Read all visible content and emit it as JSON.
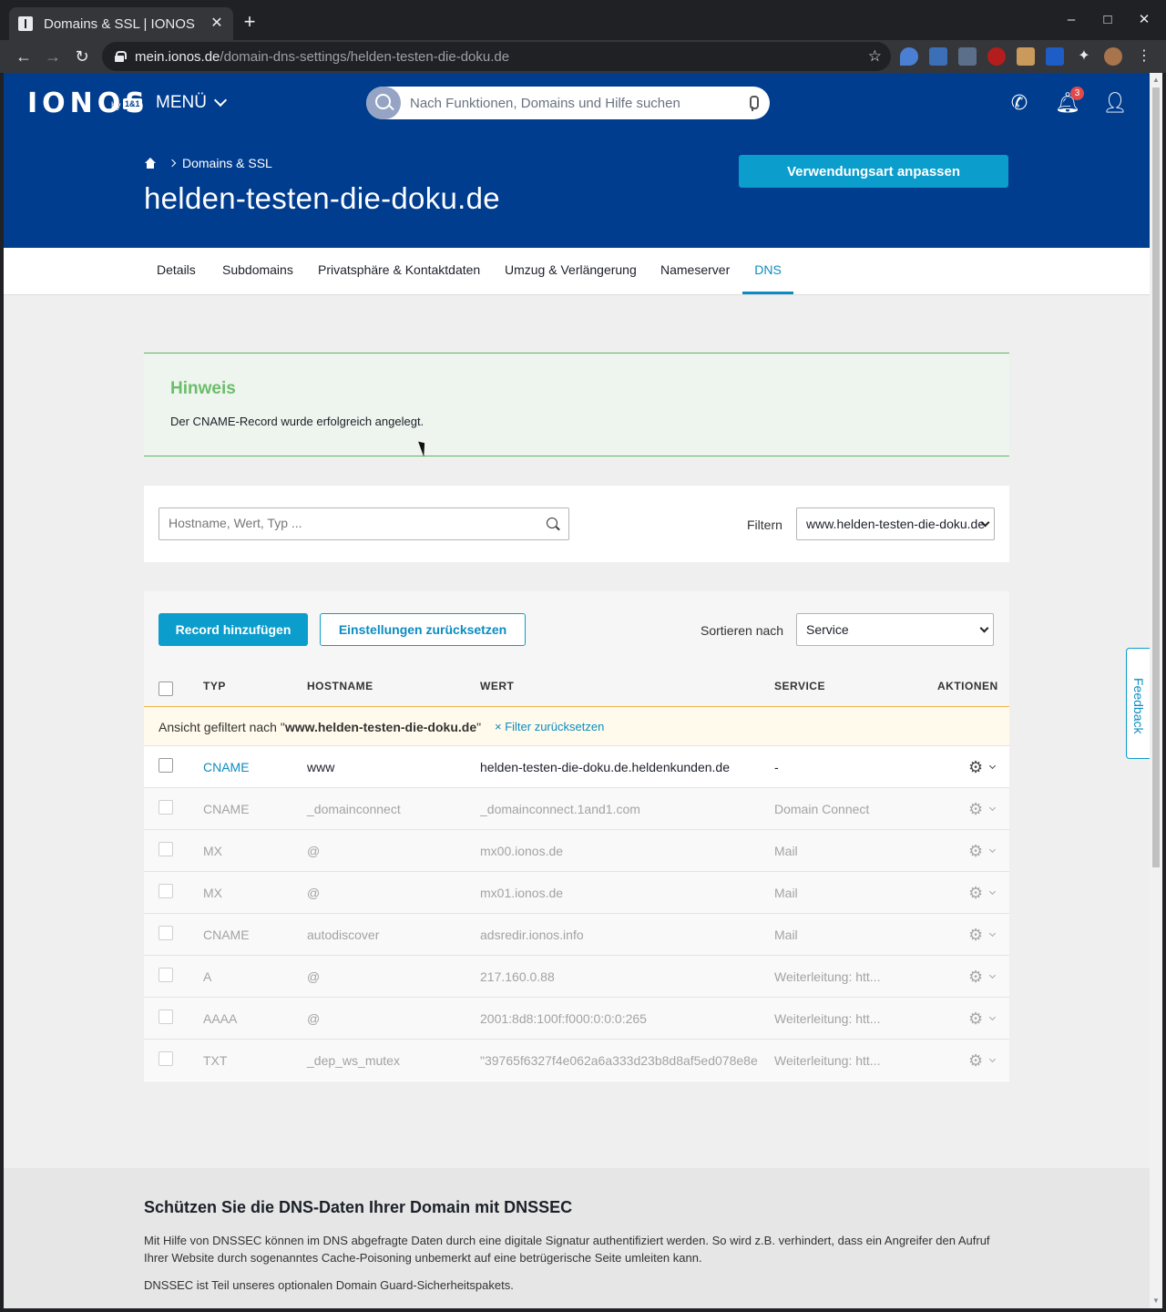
{
  "browser": {
    "tab_title": "Domains & SSL | IONOS",
    "url_host": "mein.ionos.de",
    "url_path": "/domain-dns-settings/helden-testen-die-doku.de",
    "window_controls": [
      "–",
      "□",
      "✕"
    ]
  },
  "header": {
    "logo": "IONOS",
    "logo_by": "by",
    "logo_partner": "1&1",
    "menu_label": "MENÜ",
    "search_placeholder": "Nach Funktionen, Domains und Hilfe suchen",
    "notification_count": "3"
  },
  "hero": {
    "breadcrumb": "Domains & SSL",
    "title": "helden-testen-die-doku.de",
    "usage_button": "Verwendungsart anpassen"
  },
  "tabs": [
    {
      "label": "Details"
    },
    {
      "label": "Subdomains"
    },
    {
      "label": "Privatsphäre & Kontaktdaten"
    },
    {
      "label": "Umzug & Verlängerung"
    },
    {
      "label": "Nameserver"
    },
    {
      "label": "DNS",
      "active": true
    }
  ],
  "notice": {
    "title": "Hinweis",
    "text": "Der CNAME-Record wurde erfolgreich angelegt."
  },
  "filter": {
    "search_placeholder": "Hostname, Wert, Typ ...",
    "filter_label": "Filtern",
    "filter_value": "www.helden-testen-die-doku.de"
  },
  "records": {
    "add_button": "Record hinzufügen",
    "reset_button": "Einstellungen zurücksetzen",
    "sort_label": "Sortieren nach",
    "sort_value": "Service",
    "columns": [
      "TYP",
      "HOSTNAME",
      "WERT",
      "SERVICE",
      "AKTIONEN"
    ],
    "filter_notice_prefix": "Ansicht gefiltert nach \"",
    "filter_notice_value": "www.helden-testen-die-doku.de",
    "filter_notice_suffix": "\"",
    "filter_reset": "× Filter zurücksetzen",
    "rows": [
      {
        "type": "CNAME",
        "host": "www",
        "value": "helden-testen-die-doku.de.heldenkunden.de",
        "service": "-",
        "active": true
      },
      {
        "type": "CNAME",
        "host": "_domainconnect",
        "value": "_domainconnect.1and1.com",
        "service": "Domain Connect"
      },
      {
        "type": "MX",
        "host": "@",
        "value": "mx00.ionos.de",
        "service": "Mail"
      },
      {
        "type": "MX",
        "host": "@",
        "value": "mx01.ionos.de",
        "service": "Mail"
      },
      {
        "type": "CNAME",
        "host": "autodiscover",
        "value": "adsredir.ionos.info",
        "service": "Mail"
      },
      {
        "type": "A",
        "host": "@",
        "value": "217.160.0.88",
        "service": "Weiterleitung: htt..."
      },
      {
        "type": "AAAA",
        "host": "@",
        "value": "2001:8d8:100f:f000:0:0:0:265",
        "service": "Weiterleitung: htt..."
      },
      {
        "type": "TXT",
        "host": "_dep_ws_mutex",
        "value": "\"39765f6327f4e062a6a333d23b8d8af5ed078e8e...",
        "service": "Weiterleitung: htt..."
      }
    ]
  },
  "dnssec": {
    "title": "Schützen Sie die DNS-Daten Ihrer Domain mit DNSSEC",
    "p1": "Mit Hilfe von DNSSEC können im DNS abgefragte Daten durch eine digitale Signatur authentifiziert werden. So wird z.B. verhindert, dass ein Angreifer den Aufruf Ihrer Website durch sogenanntes Cache-Poisoning unbemerkt auf eine betrügerische Seite umleiten kann.",
    "p2": "DNSSEC ist Teil unseres optionalen Domain Guard-Sicherheitspakets."
  },
  "feedback": "Feedback"
}
